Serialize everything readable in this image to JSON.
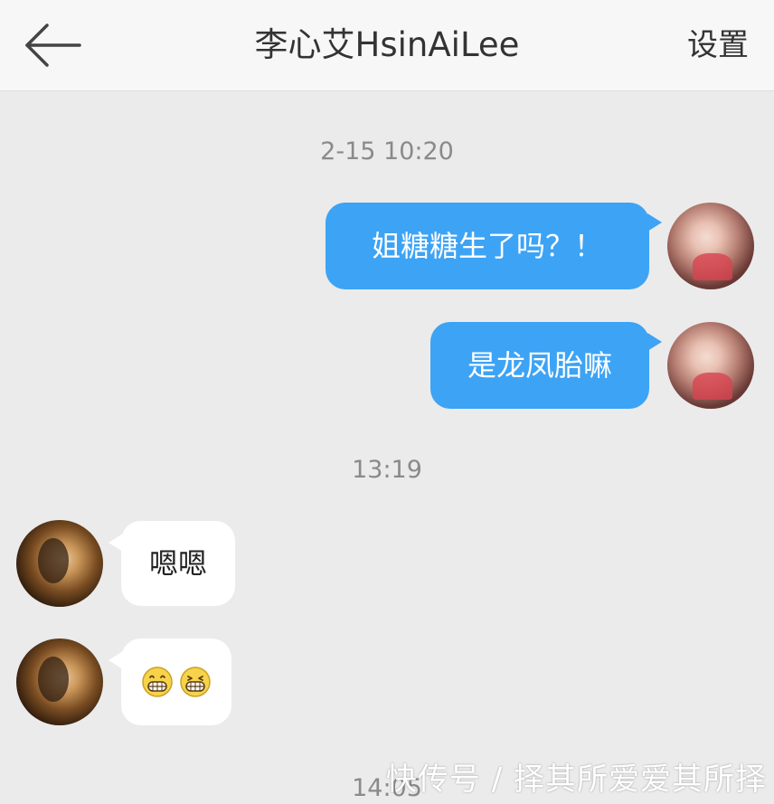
{
  "header": {
    "back_icon": "arrow-left-icon",
    "title": "李心艾HsinAiLee",
    "settings_label": "设置"
  },
  "messages": {
    "time_1": "2-15 10:20",
    "out_1": "姐糖糖生了吗？！",
    "out_2": "是龙凤胎嘛",
    "time_2": "13:19",
    "in_1": "嗯嗯",
    "in_2_icons": [
      "grin-icon",
      "grin-icon"
    ],
    "time_3": "14:05"
  },
  "watermark": "快传号 / 择其所爱爱其所择",
  "colors": {
    "outgoing_bubble": "#3da3f5",
    "incoming_bubble": "#ffffff",
    "chat_background": "#ebebeb",
    "header_background": "#f7f7f7"
  }
}
